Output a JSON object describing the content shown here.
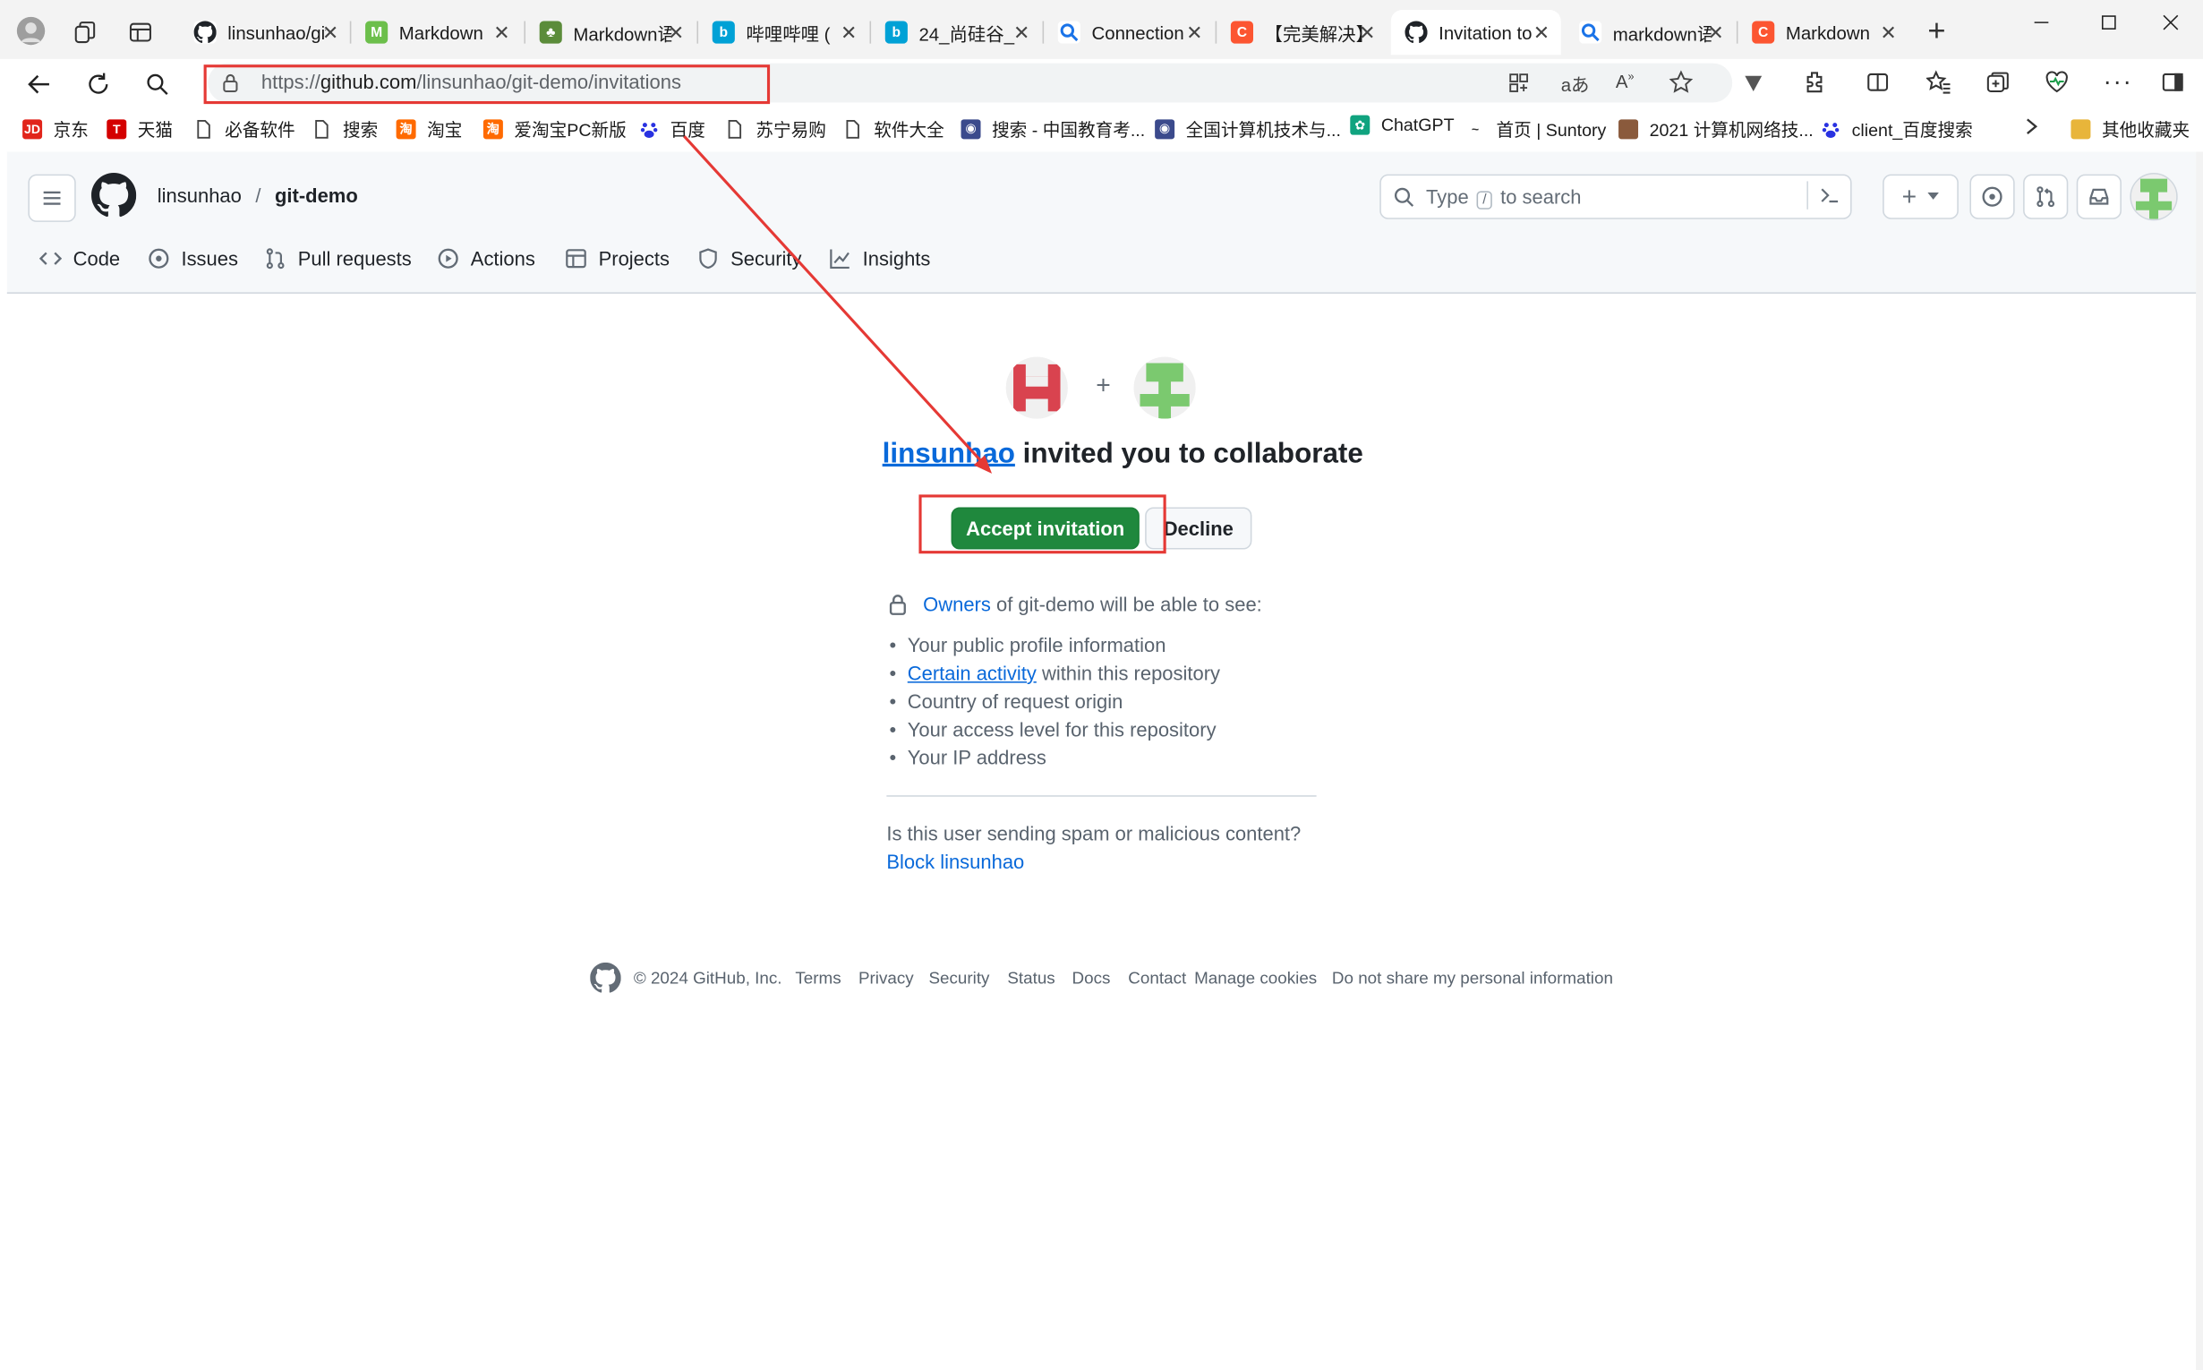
{
  "browser": {
    "tabs": [
      {
        "title": "linsunhao/git",
        "icon": "github-icon",
        "active": false
      },
      {
        "title": "Markdown",
        "icon": "markdown-app-icon",
        "active": false
      },
      {
        "title": "Markdown语",
        "icon": "tree-icon",
        "active": false
      },
      {
        "title": "哔哩哔哩 (",
        "icon": "bilibili-icon",
        "active": false
      },
      {
        "title": "24_尚硅谷_",
        "icon": "bilibili-icon",
        "active": false
      },
      {
        "title": "Connection",
        "icon": "search-icon",
        "active": false
      },
      {
        "title": "【完美解决】",
        "icon": "csdn-icon",
        "active": false
      },
      {
        "title": "Invitation to",
        "icon": "github-icon",
        "active": true
      },
      {
        "title": "markdown语",
        "icon": "search-icon",
        "active": false
      },
      {
        "title": "Markdown",
        "icon": "csdn-icon",
        "active": false
      }
    ],
    "url_prefix": "https://",
    "url_domain": "github.com",
    "url_path": "/linsunhao/git-demo/invitations",
    "favorites": [
      {
        "label": "京东",
        "icon": "jd-icon"
      },
      {
        "label": "天猫",
        "icon": "tmall-icon"
      },
      {
        "label": "必备软件",
        "icon": "page-icon"
      },
      {
        "label": "搜索",
        "icon": "page-icon"
      },
      {
        "label": "淘宝",
        "icon": "taobao-icon"
      },
      {
        "label": "爱淘宝PC新版",
        "icon": "taobao-icon"
      },
      {
        "label": "百度",
        "icon": "baidu-icon"
      },
      {
        "label": "苏宁易购",
        "icon": "page-icon"
      },
      {
        "label": "软件大全",
        "icon": "page-icon"
      },
      {
        "label": "搜索 - 中国教育考...",
        "icon": "globe-icon"
      },
      {
        "label": "全国计算机技术与...",
        "icon": "globe-icon"
      },
      {
        "label": "ChatGPT",
        "icon": "chatgpt-icon"
      },
      {
        "label": "首页 | Suntory",
        "icon": "suntory-icon"
      },
      {
        "label": "2021 计算机网络技...",
        "icon": "image-icon"
      },
      {
        "label": "client_百度搜索",
        "icon": "baidu-icon"
      }
    ],
    "other_favorites": "其他收藏夹"
  },
  "github": {
    "owner": "linsunhao",
    "separator": "/",
    "repo": "git-demo",
    "search_placeholder_pre": "Type",
    "search_key": "/",
    "search_placeholder_post": "to search",
    "nav": [
      "Code",
      "Issues",
      "Pull requests",
      "Actions",
      "Projects",
      "Security",
      "Insights"
    ]
  },
  "invitation": {
    "plus": "+",
    "inviter": "linsunhao",
    "heading_rest": " invited you to collaborate",
    "accept_label": "Accept invitation",
    "decline_label": "Decline",
    "owners_link": "Owners",
    "owners_rest": " of git-demo will be able to see:",
    "items": [
      {
        "text": "Your public profile information",
        "link": ""
      },
      {
        "text": " within this repository",
        "link": "Certain activity"
      },
      {
        "text": "Country of request origin",
        "link": ""
      },
      {
        "text": "Your access level for this repository",
        "link": ""
      },
      {
        "text": "Your IP address",
        "link": ""
      }
    ],
    "spam_question": "Is this user sending spam or malicious content?",
    "block_label": "Block linsunhao"
  },
  "footer": {
    "copyright": "© 2024 GitHub, Inc.",
    "links": [
      "Terms",
      "Privacy",
      "Security",
      "Status",
      "Docs",
      "Contact",
      "Manage cookies",
      "Do not share my personal information"
    ]
  },
  "colors": {
    "accept_green": "#1f883d",
    "link_blue": "#0969da",
    "annotation_red": "#e53935"
  }
}
